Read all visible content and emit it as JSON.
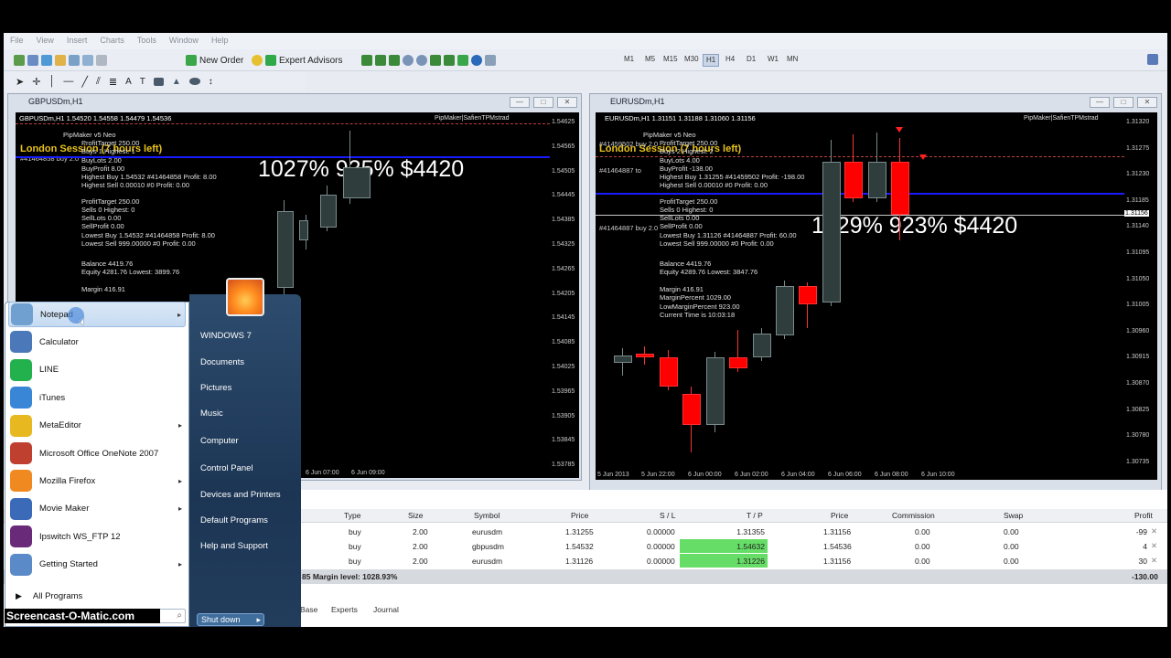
{
  "menubar": [
    "File",
    "View",
    "Insert",
    "Charts",
    "Tools",
    "Window",
    "Help"
  ],
  "toolbar": {
    "new_order": "New Order",
    "expert_advisors": "Expert Advisors",
    "timeframes": [
      "M1",
      "M5",
      "M15",
      "M30",
      "H1",
      "H4",
      "D1",
      "W1",
      "MN"
    ]
  },
  "charts": {
    "gbp": {
      "window_title": "GBPUSDm,H1",
      "header": "GBPUSDm,H1  1.54520 1.54558 1.54479 1.54536",
      "watermark": "PipMaker|SafienTPMstrad",
      "session": "London Session (7 hours left)",
      "order_label": "#41464858 buy 2.0",
      "stats": [
        "PipMaker v5 Neo",
        "ProfitTarget         250.00",
        "Buys                 1   Highest: 1",
        "BuyLots              2.00",
        "BuyProfit            8.00",
        "Highest Buy          1.54532 #41464858  Profit: 8.00",
        "Highest Sell         0.00010 #0  Profit: 0.00",
        "ProfitTarget         250.00",
        "Sells                0   Highest: 0",
        "SellLots             0.00",
        "SellProfit           0.00",
        "Lowest Buy           1.54532 #41464858  Profit: 8.00",
        "Lowest Sell          999.00000 #0  Profit: 0.00",
        "Balance              4419.76",
        "Equity               4281.76  Lowest: 3899.76",
        "Margin               416.91"
      ],
      "big": "1027%  935%  $4420",
      "yticks": [
        "1.54625",
        "1.54565",
        "1.54505",
        "1.54445",
        "1.54385",
        "1.54325",
        "1.54265",
        "1.54205",
        "1.54145",
        "1.54085",
        "1.54025",
        "1.53965",
        "1.53905",
        "1.53845",
        "1.53785"
      ],
      "xticks": [
        "6 Jun 07:00",
        "6 Jun 09:00"
      ]
    },
    "eur": {
      "window_title": "EURUSDm,H1",
      "header": "EURUSDm,H1  1.31151 1.31188 1.31060 1.31156",
      "watermark": "PipMaker|SafienTPMstrad",
      "session": "London Session (7 hours left)",
      "order_labels": [
        "#41459502 buy 2.0",
        "#41464887 to",
        "#41464887 buy 2.0"
      ],
      "stats": [
        "PipMaker v5 Neo",
        "ProfitTarget         250.00",
        "Buys                 2   Highest: 2",
        "BuyLots              4.00",
        "BuyProfit            -138.00",
        "Highest Buy          1.31255 #41459502  Profit: -198.00",
        "Highest Sell         0.00010 #0  Profit: 0.00",
        "ProfitTarget         250.00",
        "Sells                0   Highest: 0",
        "SellLots             0.00",
        "SellProfit           0.00",
        "Lowest Buy           1.31126 #41464887  Profit: 60.00",
        "Lowest Sell          999.00000 #0  Profit: 0.00",
        "Balance              4419.76",
        "Equity               4289.76  Lowest: 3847.76",
        "Margin               416.91",
        "MarginPercent        1029.00",
        "LowMarginPercent     923.00",
        "Current Time is      10:03:18"
      ],
      "big": "1029%  923%  $4420",
      "yticks": [
        "1.31320",
        "1.31275",
        "1.31230",
        "1.31185",
        "1.31140",
        "1.31095",
        "1.31050",
        "1.31005",
        "1.30960",
        "1.30915",
        "1.30870",
        "1.30825",
        "1.30780",
        "1.30735"
      ],
      "price_label": "1.31156",
      "xticks": [
        "5 Jun 2013",
        "5 Jun 22:00",
        "6 Jun 00:00",
        "6 Jun 02:00",
        "6 Jun 04:00",
        "6 Jun 06:00",
        "6 Jun 08:00",
        "6 Jun 10:00"
      ]
    }
  },
  "terminal": {
    "headers": [
      "Type",
      "Size",
      "Symbol",
      "Price",
      "S / L",
      "T / P",
      "Price",
      "Commission",
      "Swap",
      "Profit"
    ],
    "rows": [
      [
        "buy",
        "2.00",
        "eurusdm",
        "1.31255",
        "0.00000",
        "1.31355",
        "1.31156",
        "0.00",
        "0.00",
        "-99"
      ],
      [
        "buy",
        "2.00",
        "gbpusdm",
        "1.54532",
        "0.00000",
        "1.54632",
        "1.54536",
        "0.00",
        "0.00",
        "4"
      ],
      [
        "buy",
        "2.00",
        "eurusdm",
        "1.31126",
        "0.00000",
        "1.31226",
        "1.31156",
        "0.00",
        "0.00",
        "30"
      ]
    ],
    "summary_left": "85  Margin level: 1028.93%",
    "summary_right": "-130.00",
    "tabs": [
      "Base",
      "Experts",
      "Journal"
    ]
  },
  "startmenu": {
    "left_items": [
      "Notepad",
      "Calculator",
      "LINE",
      "iTunes",
      "MetaEditor",
      "Microsoft Office OneNote 2007",
      "Mozilla Firefox",
      "Movie Maker",
      "Ipswitch WS_FTP 12",
      "Getting Started"
    ],
    "all_programs": "All Programs",
    "right_items": [
      "WINDOWS 7",
      "Documents",
      "Pictures",
      "Music",
      "Computer",
      "Control Panel",
      "Devices and Printers",
      "Default Programs",
      "Help and Support"
    ],
    "shutdown": "Shut down"
  },
  "watermark": "Screencast-O-Matic.com",
  "colors": {
    "bull": "#2f3d3d",
    "bear": "#ff0000",
    "accent_tp": "#66dd66",
    "session": "#e8c21a"
  }
}
